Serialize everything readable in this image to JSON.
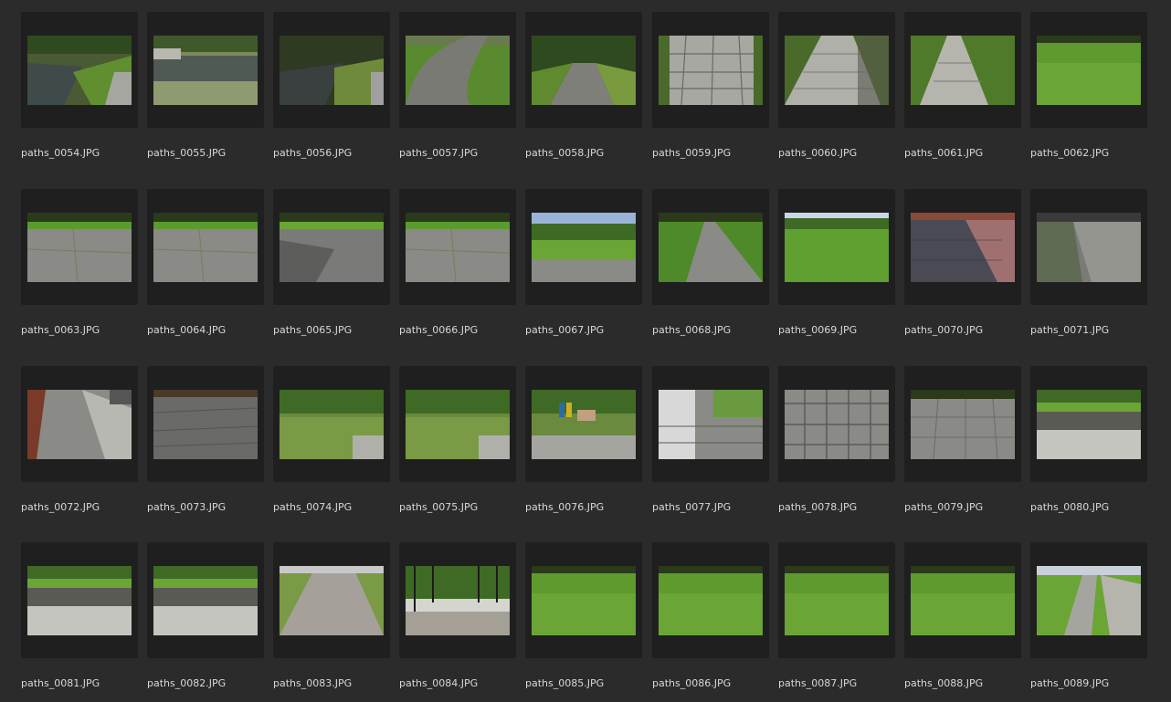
{
  "browser": {
    "thumbnails": [
      {
        "filename": "paths_0054.JPG",
        "scene": "stream"
      },
      {
        "filename": "paths_0055.JPG",
        "scene": "stream-wide"
      },
      {
        "filename": "paths_0056.JPG",
        "scene": "stream-dark"
      },
      {
        "filename": "paths_0057.JPG",
        "scene": "curved-path"
      },
      {
        "filename": "paths_0058.JPG",
        "scene": "alley"
      },
      {
        "filename": "paths_0059.JPG",
        "scene": "stone-slabs"
      },
      {
        "filename": "paths_0060.JPG",
        "scene": "slab-path"
      },
      {
        "filename": "paths_0061.JPG",
        "scene": "slab-path-narrow"
      },
      {
        "filename": "paths_0062.JPG",
        "scene": "lawn"
      },
      {
        "filename": "paths_0063.JPG",
        "scene": "plaza"
      },
      {
        "filename": "paths_0064.JPG",
        "scene": "plaza"
      },
      {
        "filename": "paths_0065.JPG",
        "scene": "plaza-shadow"
      },
      {
        "filename": "paths_0066.JPG",
        "scene": "plaza"
      },
      {
        "filename": "paths_0067.JPG",
        "scene": "park-trees"
      },
      {
        "filename": "paths_0068.JPG",
        "scene": "park-path"
      },
      {
        "filename": "paths_0069.JPG",
        "scene": "lawn-sky"
      },
      {
        "filename": "paths_0070.JPG",
        "scene": "tiles"
      },
      {
        "filename": "paths_0071.JPG",
        "scene": "cobble-street"
      },
      {
        "filename": "paths_0072.JPG",
        "scene": "sidewalk-wall"
      },
      {
        "filename": "paths_0073.JPG",
        "scene": "cobble"
      },
      {
        "filename": "paths_0074.JPG",
        "scene": "hedge"
      },
      {
        "filename": "paths_0075.JPG",
        "scene": "hedge"
      },
      {
        "filename": "paths_0076.JPG",
        "scene": "hedge-bins"
      },
      {
        "filename": "paths_0077.JPG",
        "scene": "steps"
      },
      {
        "filename": "paths_0078.JPG",
        "scene": "concrete-tiles"
      },
      {
        "filename": "paths_0079.JPG",
        "scene": "paving"
      },
      {
        "filename": "paths_0080.JPG",
        "scene": "stone-wall"
      },
      {
        "filename": "paths_0081.JPG",
        "scene": "stone-wall"
      },
      {
        "filename": "paths_0082.JPG",
        "scene": "stone-wall"
      },
      {
        "filename": "paths_0083.JPG",
        "scene": "gravel-path"
      },
      {
        "filename": "paths_0084.JPG",
        "scene": "fence"
      },
      {
        "filename": "paths_0085.JPG",
        "scene": "lawn"
      },
      {
        "filename": "paths_0086.JPG",
        "scene": "lawn"
      },
      {
        "filename": "paths_0087.JPG",
        "scene": "lawn"
      },
      {
        "filename": "paths_0088.JPG",
        "scene": "lawn"
      },
      {
        "filename": "paths_0089.JPG",
        "scene": "edge-path"
      }
    ]
  }
}
